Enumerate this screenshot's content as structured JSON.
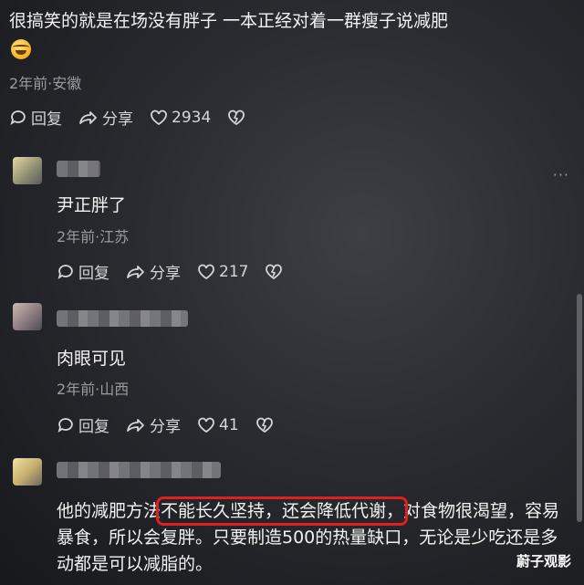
{
  "top_comment": {
    "text": "很搞笑的就是在场没有胖子    一本正经对着一群瘦子说减肥",
    "emoji": "laughing-emoji",
    "meta": "2年前·安徽",
    "reply_label": "回复",
    "share_label": "分享",
    "like_count": "2934"
  },
  "replies": [
    {
      "text": "尹正胖了",
      "meta": "2年前·江苏",
      "reply_label": "回复",
      "share_label": "分享",
      "like_count": "217"
    },
    {
      "text": "肉眼可见",
      "meta": "2年前·山西",
      "reply_label": "回复",
      "share_label": "分享",
      "like_count": "41"
    }
  ],
  "last_comment": {
    "text_before": "他的减肥方法",
    "text_highlight": "不能长久坚持，还会降低代谢，",
    "text_after": "对食物很渴望，容易暴食，所以会复胖。只要制造500的热量缺口，无论是少吃还是多动都是可以减脂的。"
  },
  "more_menu": "···",
  "watermark": "蔚子观影",
  "colors": {
    "highlight_box": "#e01f1f",
    "meta_text": "#9a9b9f"
  }
}
